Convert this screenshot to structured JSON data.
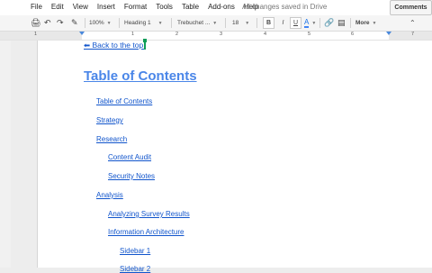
{
  "menu": [
    "File",
    "Edit",
    "View",
    "Insert",
    "Format",
    "Tools",
    "Table",
    "Add-ons",
    "Help"
  ],
  "status": "All changes saved in Drive",
  "comments_label": "Comments",
  "toolbar": {
    "zoom": "100%",
    "style": "Heading 1",
    "font": "Trebuchet ...",
    "size": "18",
    "bold": "B",
    "italic": "I",
    "underline": "U",
    "text_color": "A",
    "more": "More"
  },
  "ruler_numbers": [
    "1",
    "1",
    "2",
    "3",
    "4",
    "5",
    "6",
    "7"
  ],
  "back_link": "⬅ Back to the top.",
  "toc_title": "Table of Contents",
  "toc_items": [
    {
      "label": "Table of Contents",
      "level": 1
    },
    {
      "label": "Strategy",
      "level": 1
    },
    {
      "label": "Research",
      "level": 1
    },
    {
      "label": "Content Audit",
      "level": 2
    },
    {
      "label": "Security Notes",
      "level": 2
    },
    {
      "label": "Analysis",
      "level": 1
    },
    {
      "label": "Analyzing Survey Results",
      "level": 2
    },
    {
      "label": "Information Architecture",
      "level": 2
    },
    {
      "label": "Sidebar 1",
      "level": 3
    },
    {
      "label": "Sidebar 2",
      "level": 3
    }
  ]
}
